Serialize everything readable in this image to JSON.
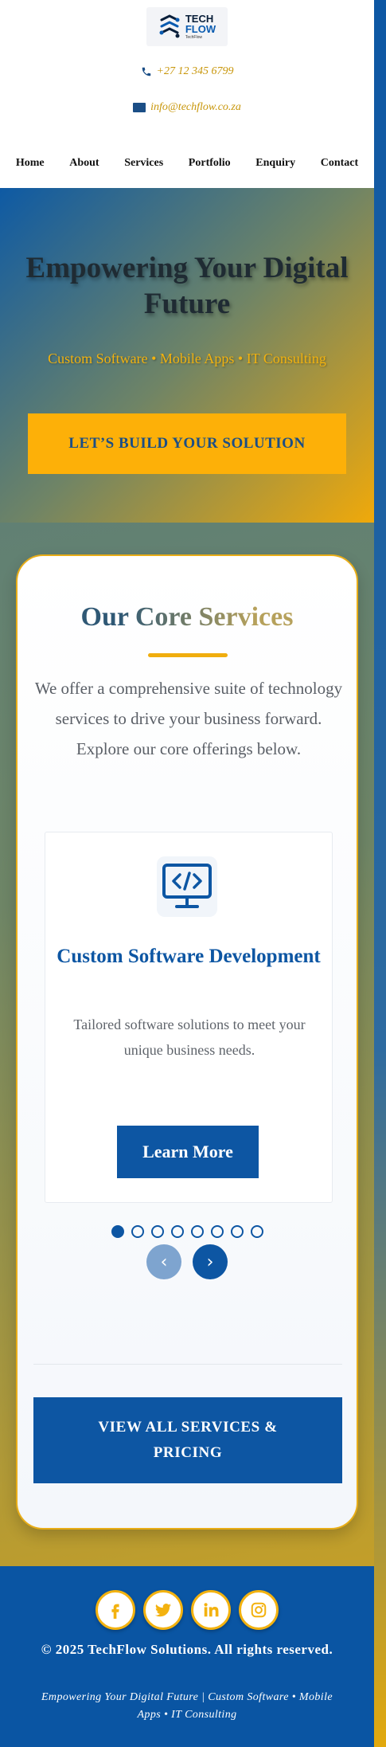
{
  "brand": {
    "logo_line1": "TECH",
    "logo_line2": "FLOW",
    "logo_line3": "TechFlow"
  },
  "contact": {
    "phone": "+27 12 345 6799",
    "email": "info@techflow.co.za"
  },
  "nav": {
    "items": [
      "Home",
      "About",
      "Services",
      "Portfolio",
      "Enquiry",
      "Contact"
    ]
  },
  "hero": {
    "title": "Empowering Your Digital Future",
    "subtitle": "Custom Software • Mobile Apps • IT Consulting",
    "cta_label": "LET’S BUILD YOUR SOLUTION"
  },
  "services": {
    "title": "Our Core Services",
    "intro": "We offer a comprehensive suite of technology services to drive your business forward. Explore our core offerings below.",
    "slide": {
      "icon": "code-monitor-icon",
      "title": "Custom Software Development",
      "description": "Tailored software solutions to meet your unique business needs.",
      "button_label": "Learn More"
    },
    "carousel": {
      "slide_count": 8,
      "active_index": 0,
      "prev_label": "‹",
      "next_label": "›"
    },
    "view_all_label": "VIEW ALL SERVICES & PRICING"
  },
  "footer": {
    "socials": [
      "facebook-icon",
      "twitter-icon",
      "linkedin-icon",
      "instagram-icon"
    ],
    "copyright": "© 2025 TechFlow Solutions. All rights reserved.",
    "tagline": "Empowering Your Digital Future | Custom Software • Mobile Apps • IT Consulting"
  },
  "colors": {
    "primary_blue": "#0d56a3",
    "accent_gold": "#fdb008",
    "card_border": "#e8ad17"
  }
}
